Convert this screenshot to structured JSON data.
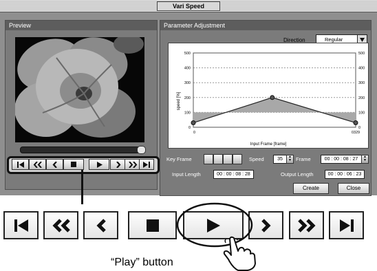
{
  "window": {
    "title": "Vari Speed"
  },
  "preview": {
    "header": "Preview",
    "scrub_value": 1.0,
    "controls": [
      {
        "name": "go-to-start",
        "icon": "skip-to-start-icon"
      },
      {
        "name": "rewind",
        "icon": "fast-rewind-icon"
      },
      {
        "name": "step-back",
        "icon": "step-back-icon"
      },
      {
        "name": "stop",
        "icon": "stop-icon"
      },
      {
        "name": "play",
        "icon": "play-icon"
      },
      {
        "name": "step-forward",
        "icon": "step-forward-icon"
      },
      {
        "name": "fast-forward",
        "icon": "fast-forward-icon"
      },
      {
        "name": "go-to-end",
        "icon": "skip-to-end-icon"
      }
    ]
  },
  "params": {
    "header": "Parameter Adjustment",
    "direction_label": "Direction",
    "direction_value": "Regular",
    "graph": {
      "ylabel": "speed [%]",
      "xlabel": "Input Frame [frame]",
      "yticks": [
        "500",
        "400",
        "300",
        "200",
        "100",
        "0"
      ],
      "x_start": "0",
      "x_end": "0329"
    },
    "keyframe_label": "Key Frame",
    "speed_label": "Speed",
    "speed_value": "35",
    "frame_label": "Frame",
    "frame_value": "00 : 00 : 08 : 27",
    "input_length_label": "Input Length",
    "input_length_value": "00 : 00 : 08 : 28",
    "output_length_label": "Output Length",
    "output_length_value": "00 : 00 : 06 : 23",
    "create_label": "Create",
    "close_label": "Close"
  },
  "chart_data": {
    "type": "line",
    "x": [
      0,
      160,
      329
    ],
    "values": [
      30,
      200,
      30
    ],
    "xlabel": "Input Frame [frame]",
    "ylabel": "speed [%]",
    "ylim": [
      0,
      500
    ],
    "xlim": [
      0,
      329
    ]
  },
  "callout": {
    "label": "“Play” button"
  },
  "colors": {
    "window_bg": "#8f8f8f",
    "panel_header": "#5d5d5d",
    "graph_fill": "#a8a8a8"
  }
}
